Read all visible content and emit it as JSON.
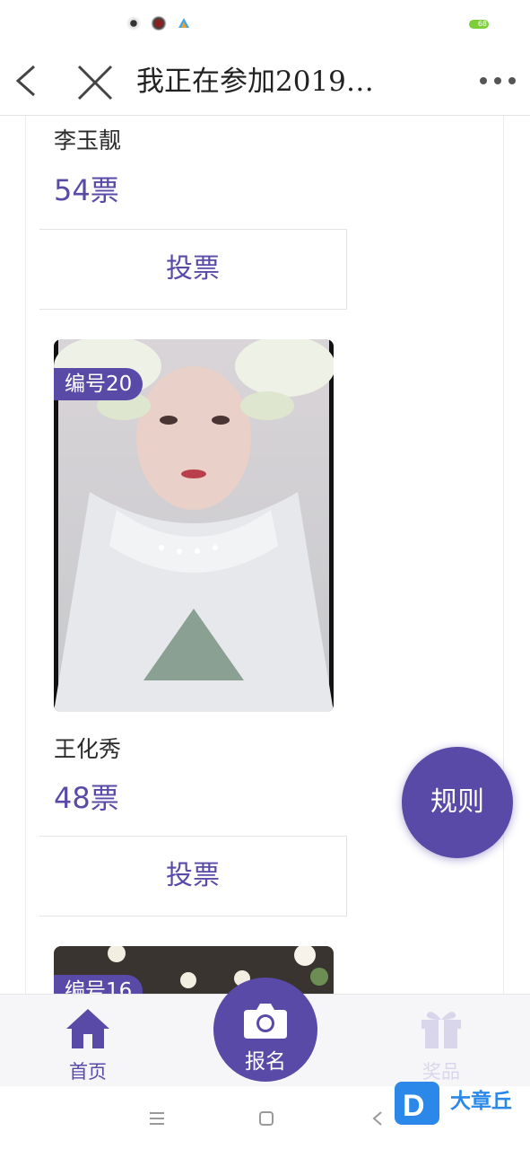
{
  "status_bar": {
    "battery": "68"
  },
  "nav": {
    "title": "我正在参加2019…"
  },
  "contestants": [
    {
      "name": "李玉靓",
      "votes": "54票",
      "vote_button": "投票"
    },
    {
      "badge": "编号20",
      "name": "王化秀",
      "votes": "48票",
      "vote_button": "投票"
    },
    {
      "badge": "编号16"
    }
  ],
  "fab": {
    "label": "规则"
  },
  "tabbar": {
    "home": "首页",
    "signup": "报名",
    "prize": "奖品"
  },
  "watermark": {
    "text": "大章丘"
  },
  "colors": {
    "accent": "#5a4aa8",
    "prize_inactive": "#d9d6ec"
  }
}
